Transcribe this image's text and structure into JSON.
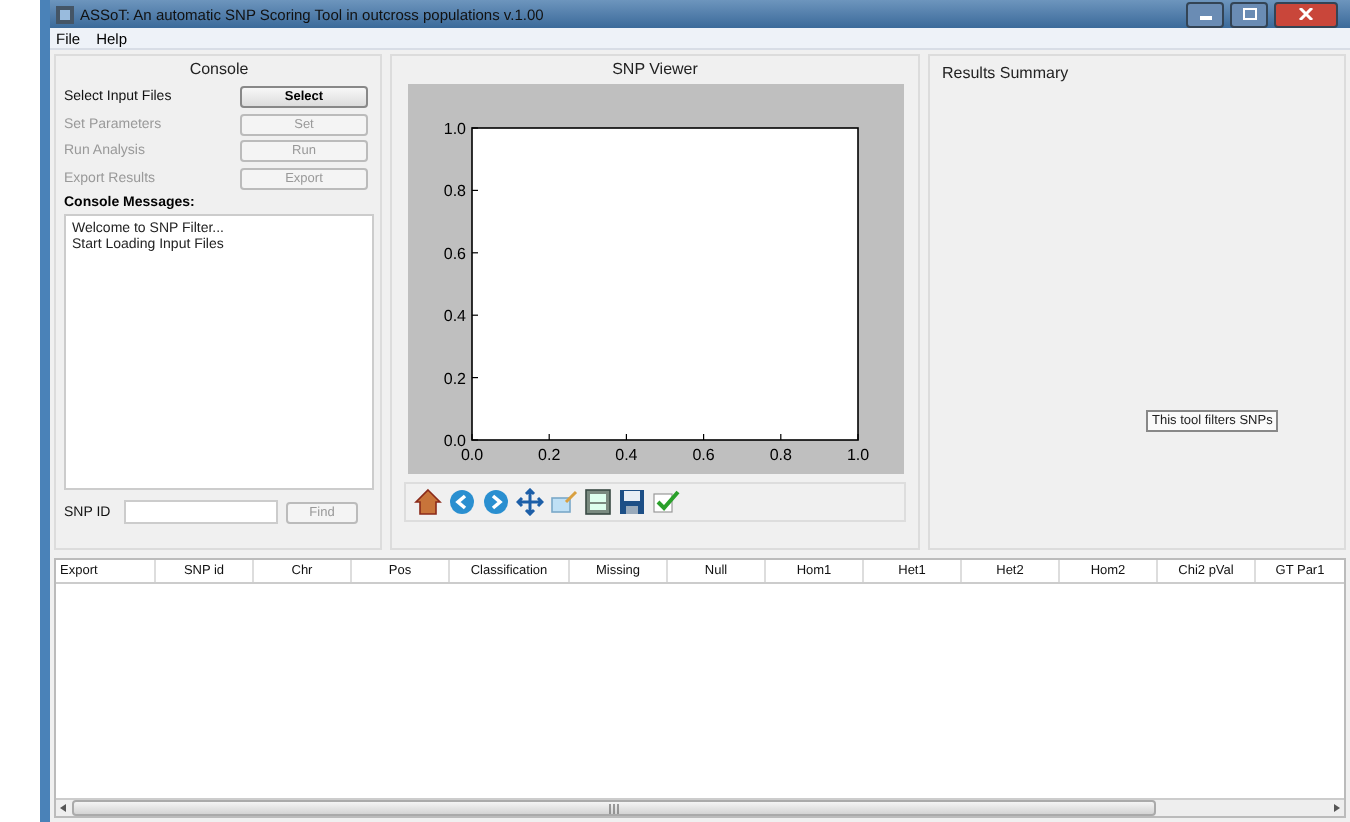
{
  "window": {
    "title": "ASSoT: An automatic SNP Scoring Tool in outcross populations v.1.00"
  },
  "menu": [
    "File",
    "Help"
  ],
  "console": {
    "title": "Console",
    "actions": [
      {
        "label": "Select Input Files",
        "button": "Select",
        "disabled": false
      },
      {
        "label": "Set Parameters",
        "button": "Set",
        "disabled": true
      },
      {
        "label": "Run Analysis",
        "button": "Run",
        "disabled": true
      },
      {
        "label": "Export Results",
        "button": "Export",
        "disabled": true
      }
    ],
    "messages_title": "Console Messages:",
    "messages": [
      "Welcome to SNP Filter...",
      "Start Loading Input Files"
    ],
    "snp_id_label": "SNP ID",
    "find_button": "Find",
    "find_disabled": true
  },
  "viewer": {
    "title": "SNP Viewer",
    "chart_data": {
      "type": "line",
      "xlim": [
        0,
        1
      ],
      "ylim": [
        0,
        1
      ],
      "xticks": [
        {
          "value": 0,
          "label": "0.0"
        },
        {
          "value": 0.2,
          "label": "0.2"
        },
        {
          "value": 0.4,
          "label": "0.4"
        },
        {
          "value": 0.6,
          "label": "0.6"
        },
        {
          "value": 0.8,
          "label": "0.8"
        },
        {
          "value": 1,
          "label": "1.0"
        }
      ],
      "yticks": [
        {
          "value": 0,
          "label": "0.0"
        },
        {
          "value": 0.2,
          "label": "0.2"
        },
        {
          "value": 0.4,
          "label": "0.4"
        },
        {
          "value": 0.6,
          "label": "0.6"
        },
        {
          "value": 0.8,
          "label": "0.8"
        },
        {
          "value": 1,
          "label": "1.0"
        }
      ]
    }
  },
  "results": {
    "title": "Results Summary",
    "tooltip": "This tool filters SNPs"
  },
  "table": {
    "columns": [
      "Export",
      "SNP id",
      "Chr",
      "Pos",
      "Classification",
      "Missing",
      "Null",
      "Hom1",
      "Het1",
      "Het2",
      "Hom2",
      "Chi2 pVal",
      "GT Par1"
    ]
  }
}
